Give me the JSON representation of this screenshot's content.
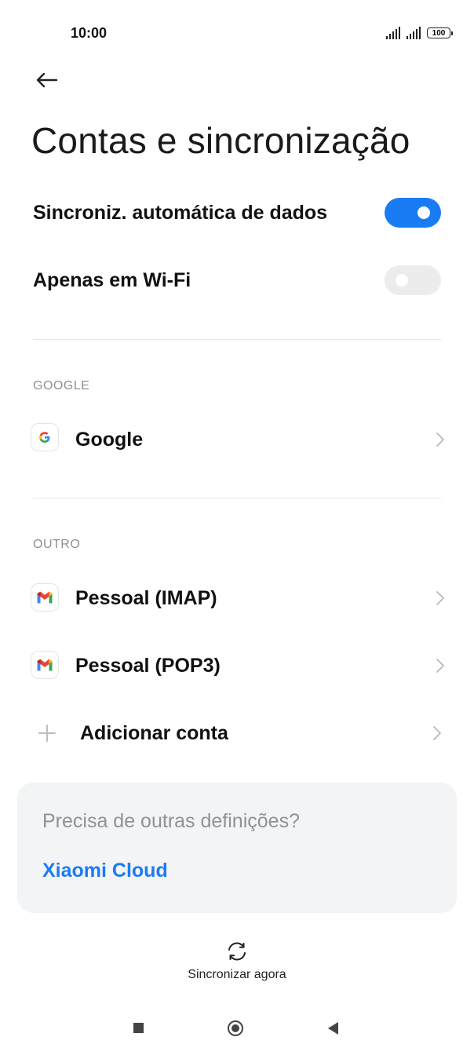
{
  "status_bar": {
    "time": "10:00",
    "battery": "100"
  },
  "header": {
    "title": "Contas e sincronização"
  },
  "settings": [
    {
      "label": "Sincroniz. automática de dados",
      "state": "on"
    },
    {
      "label": "Apenas em Wi-Fi",
      "state": "off"
    }
  ],
  "sections": {
    "google": {
      "header": "GOOGLE",
      "items": [
        {
          "label": "Google",
          "icon": "google-icon"
        }
      ]
    },
    "other": {
      "header": "OUTRO",
      "items": [
        {
          "label": "Pessoal (IMAP)",
          "icon": "gmail-icon"
        },
        {
          "label": "Pessoal (POP3)",
          "icon": "gmail-icon"
        },
        {
          "label": "Adicionar conta",
          "icon": "plus-icon"
        }
      ]
    }
  },
  "card": {
    "question": "Precisa de outras definições?",
    "link": "Xiaomi Cloud"
  },
  "bottom": {
    "sync_label": "Sincronizar agora",
    "sync_icon": "sync-icon"
  },
  "colors": {
    "accent": "#1a7cf5",
    "toggle_off": "#ececec",
    "card_bg": "#f3f4f5"
  }
}
